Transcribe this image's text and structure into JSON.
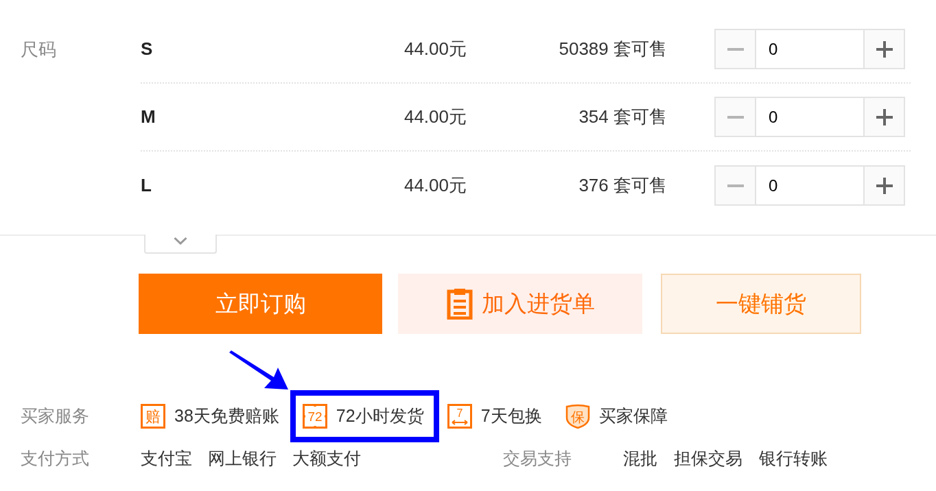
{
  "sizes": {
    "label": "尺码",
    "rows": [
      {
        "size": "S",
        "price": "44.00元",
        "stock": "50389 套可售",
        "quantity": "0"
      },
      {
        "size": "M",
        "price": "44.00元",
        "stock": "354 套可售",
        "quantity": "0"
      },
      {
        "size": "L",
        "price": "44.00元",
        "stock": "376 套可售",
        "quantity": "0"
      }
    ]
  },
  "expand_toggle": {
    "expanded": false
  },
  "actions": [
    {
      "label": "立即订购",
      "kind": "primary"
    },
    {
      "label": "加入进货单",
      "kind": "cart"
    },
    {
      "label": "一键铺货",
      "kind": "outline"
    }
  ],
  "services": {
    "label": "买家服务",
    "items": [
      {
        "badge": "赔",
        "label": "38天免费赔账",
        "kind": "box",
        "highlighted": false
      },
      {
        "badge": "72",
        "label": "72小时发货",
        "kind": "box-dots",
        "highlighted": true
      },
      {
        "badge": "7",
        "label": "7天包换",
        "kind": "box-arrow",
        "highlighted": false
      },
      {
        "badge": "保",
        "label": "买家保障",
        "kind": "shield",
        "highlighted": false
      }
    ]
  },
  "payment": {
    "label": "支付方式",
    "methods": [
      "支付宝",
      "网上银行",
      "大额支付"
    ]
  },
  "trade": {
    "label": "交易支持",
    "options": [
      "混批",
      "担保交易",
      "银行转账"
    ]
  }
}
